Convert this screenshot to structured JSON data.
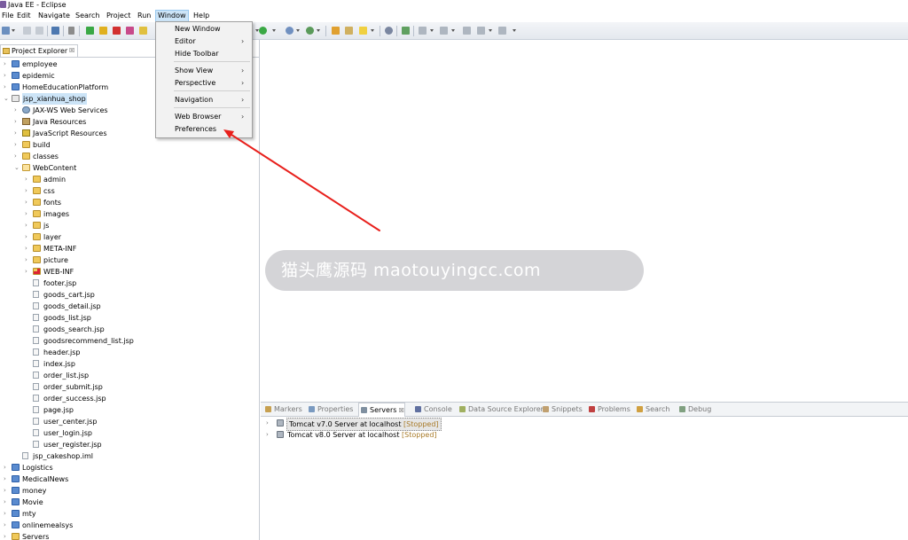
{
  "window": {
    "title": "Java EE - Eclipse"
  },
  "menubar": {
    "items": [
      "File",
      "Edit",
      "Navigate",
      "Search",
      "Project",
      "Run",
      "Window",
      "Help"
    ],
    "active": "Window"
  },
  "window_menu": {
    "items": [
      {
        "label": "New Window",
        "submenu": false
      },
      {
        "label": "Editor",
        "submenu": true
      },
      {
        "label": "Hide Toolbar",
        "submenu": false
      },
      {
        "label": "Show View",
        "submenu": true
      },
      {
        "label": "Perspective",
        "submenu": true
      },
      {
        "label": "Navigation",
        "submenu": true
      },
      {
        "label": "Web Browser",
        "submenu": true
      },
      {
        "label": "Preferences",
        "submenu": false
      }
    ]
  },
  "project_explorer": {
    "tab_label": "Project Explorer",
    "close_glyph": "☒",
    "items": [
      {
        "label": "employee",
        "depth": 0,
        "expand": "collapsed",
        "icon": "project-icon"
      },
      {
        "label": "epidemic",
        "depth": 0,
        "expand": "collapsed",
        "icon": "project-icon"
      },
      {
        "label": "HomeEducationPlatform",
        "depth": 0,
        "expand": "collapsed",
        "icon": "project-icon"
      },
      {
        "label": "jsp_xianhua_shop",
        "depth": 0,
        "expand": "expanded",
        "icon": "open-project-icon",
        "selected": true
      },
      {
        "label": "JAX-WS Web Services",
        "depth": 1,
        "expand": "collapsed",
        "icon": "web-services-icon"
      },
      {
        "label": "Java Resources",
        "depth": 1,
        "expand": "collapsed",
        "icon": "java-resources-icon"
      },
      {
        "label": "JavaScript Resources",
        "depth": 1,
        "expand": "collapsed",
        "icon": "javascript-resources-icon"
      },
      {
        "label": "build",
        "depth": 1,
        "expand": "collapsed",
        "icon": "folder-icon"
      },
      {
        "label": "classes",
        "depth": 1,
        "expand": "collapsed",
        "icon": "folder-icon"
      },
      {
        "label": "WebContent",
        "depth": 1,
        "expand": "expanded",
        "icon": "open-folder-icon"
      },
      {
        "label": "admin",
        "depth": 2,
        "expand": "collapsed",
        "icon": "folder-icon"
      },
      {
        "label": "css",
        "depth": 2,
        "expand": "collapsed",
        "icon": "folder-icon"
      },
      {
        "label": "fonts",
        "depth": 2,
        "expand": "collapsed",
        "icon": "folder-icon"
      },
      {
        "label": "images",
        "depth": 2,
        "expand": "collapsed",
        "icon": "folder-icon"
      },
      {
        "label": "js",
        "depth": 2,
        "expand": "collapsed",
        "icon": "folder-icon"
      },
      {
        "label": "layer",
        "depth": 2,
        "expand": "collapsed",
        "icon": "folder-icon"
      },
      {
        "label": "META-INF",
        "depth": 2,
        "expand": "collapsed",
        "icon": "folder-icon"
      },
      {
        "label": "picture",
        "depth": 2,
        "expand": "collapsed",
        "icon": "folder-icon"
      },
      {
        "label": "WEB-INF",
        "depth": 2,
        "expand": "collapsed",
        "icon": "web-inf-folder-icon"
      },
      {
        "label": "footer.jsp",
        "depth": 2,
        "expand": "none",
        "icon": "jsp-file-icon"
      },
      {
        "label": "goods_cart.jsp",
        "depth": 2,
        "expand": "none",
        "icon": "jsp-file-icon"
      },
      {
        "label": "goods_detail.jsp",
        "depth": 2,
        "expand": "none",
        "icon": "jsp-file-icon"
      },
      {
        "label": "goods_list.jsp",
        "depth": 2,
        "expand": "none",
        "icon": "jsp-file-icon"
      },
      {
        "label": "goods_search.jsp",
        "depth": 2,
        "expand": "none",
        "icon": "jsp-file-icon"
      },
      {
        "label": "goodsrecommend_list.jsp",
        "depth": 2,
        "expand": "none",
        "icon": "jsp-file-icon"
      },
      {
        "label": "header.jsp",
        "depth": 2,
        "expand": "none",
        "icon": "jsp-file-icon"
      },
      {
        "label": "index.jsp",
        "depth": 2,
        "expand": "none",
        "icon": "jsp-file-icon"
      },
      {
        "label": "order_list.jsp",
        "depth": 2,
        "expand": "none",
        "icon": "jsp-file-icon"
      },
      {
        "label": "order_submit.jsp",
        "depth": 2,
        "expand": "none",
        "icon": "jsp-file-icon"
      },
      {
        "label": "order_success.jsp",
        "depth": 2,
        "expand": "none",
        "icon": "jsp-file-icon"
      },
      {
        "label": "page.jsp",
        "depth": 2,
        "expand": "none",
        "icon": "jsp-file-icon"
      },
      {
        "label": "user_center.jsp",
        "depth": 2,
        "expand": "none",
        "icon": "jsp-file-icon"
      },
      {
        "label": "user_login.jsp",
        "depth": 2,
        "expand": "none",
        "icon": "jsp-file-icon"
      },
      {
        "label": "user_register.jsp",
        "depth": 2,
        "expand": "none",
        "icon": "jsp-file-icon"
      },
      {
        "label": "jsp_cakeshop.iml",
        "depth": 1,
        "expand": "none",
        "icon": "file-icon"
      },
      {
        "label": "Logistics",
        "depth": 0,
        "expand": "collapsed",
        "icon": "project-icon"
      },
      {
        "label": "MedicalNews",
        "depth": 0,
        "expand": "collapsed",
        "icon": "project-icon"
      },
      {
        "label": "money",
        "depth": 0,
        "expand": "collapsed",
        "icon": "project-icon"
      },
      {
        "label": "Movie",
        "depth": 0,
        "expand": "collapsed",
        "icon": "project-icon"
      },
      {
        "label": "mty",
        "depth": 0,
        "expand": "collapsed",
        "icon": "project-icon"
      },
      {
        "label": "onlinemealsys",
        "depth": 0,
        "expand": "collapsed",
        "icon": "project-icon"
      },
      {
        "label": "Servers",
        "depth": 0,
        "expand": "collapsed",
        "icon": "folder-icon"
      }
    ]
  },
  "bottom_panel": {
    "tabs": [
      {
        "label": "Markers",
        "icon": "markers-icon",
        "active": false
      },
      {
        "label": "Properties",
        "icon": "properties-icon",
        "active": false
      },
      {
        "label": "Servers",
        "icon": "servers-icon",
        "active": true,
        "close": "☒"
      },
      {
        "label": "Console",
        "icon": "console-icon",
        "active": false
      },
      {
        "label": "Data Source Explorer",
        "icon": "data-source-icon",
        "active": false
      },
      {
        "label": "Snippets",
        "icon": "snippets-icon",
        "active": false
      },
      {
        "label": "Problems",
        "icon": "problems-icon",
        "active": false
      },
      {
        "label": "Search",
        "icon": "search-icon",
        "active": false
      },
      {
        "label": "Debug",
        "icon": "debug-icon",
        "active": false
      }
    ],
    "servers": [
      {
        "name": "Tomcat v7.0 Server at localhost",
        "status": "[Stopped]",
        "selected": true
      },
      {
        "name": "Tomcat v8.0 Server at localhost",
        "status": "[Stopped]",
        "selected": false
      }
    ]
  },
  "watermark": {
    "text": "猫头鹰源码 maotouyingcc.com"
  },
  "colors": {
    "selection": "#cce4f7",
    "annotation_arrow": "#e8201c",
    "status_text": "#a87a28"
  }
}
